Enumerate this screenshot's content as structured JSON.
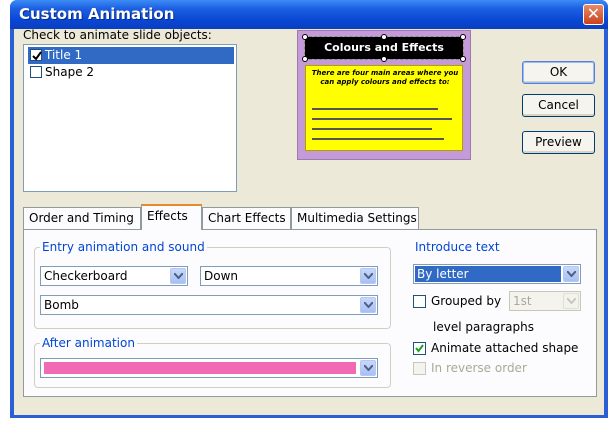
{
  "window": {
    "title": "Custom Animation",
    "close_glyph": "✕"
  },
  "objects": {
    "label": "Check to animate slide objects:",
    "items": [
      {
        "label": "Title 1",
        "checked": true,
        "selected": true
      },
      {
        "label": "Shape 2",
        "checked": false,
        "selected": false
      }
    ]
  },
  "preview": {
    "slide_title": "Colours and Effects",
    "slide_body": "There are four main areas where you can apply colours and effects to:"
  },
  "buttons": {
    "ok": "OK",
    "cancel": "Cancel",
    "preview": "Preview"
  },
  "tabs": [
    {
      "label": "Order and Timing",
      "active": false
    },
    {
      "label": "Effects",
      "active": true
    },
    {
      "label": "Chart Effects",
      "active": false
    },
    {
      "label": "Multimedia Settings",
      "active": false
    }
  ],
  "entry": {
    "legend": "Entry animation and sound",
    "effect": "Checkerboard",
    "direction": "Down",
    "sound": "Bomb"
  },
  "after": {
    "legend": "After animation",
    "color": "#f06bb3"
  },
  "introduce": {
    "legend": "Introduce text",
    "value": "By letter",
    "grouped_label": "Grouped by",
    "grouped_value": "1st",
    "level_label": "level paragraphs",
    "animate_label": "Animate attached shape",
    "animate_checked": true,
    "reverse_label": "In reverse order",
    "reverse_checked": false
  },
  "icons": {
    "close": "close-icon",
    "dropdown": "chevron-down-icon",
    "check": "checkmark-icon"
  },
  "colors": {
    "title_bar": "#0a46d4",
    "selection": "#316ac5",
    "dialog_bg": "#ece9d8",
    "group_legend": "#0046d5"
  }
}
